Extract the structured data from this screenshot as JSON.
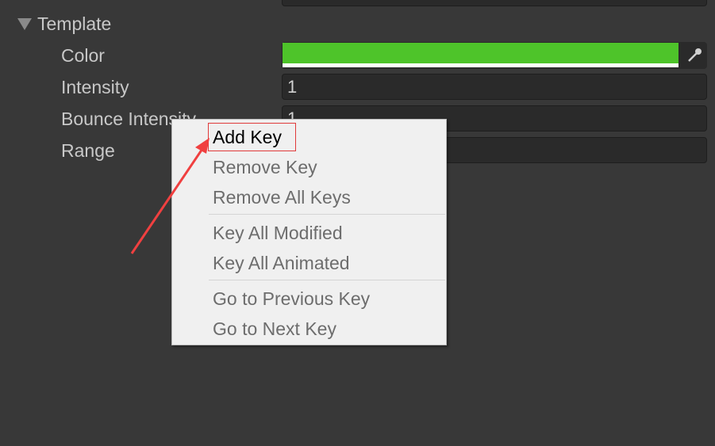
{
  "section": {
    "title": "Template",
    "expanded": true
  },
  "properties": [
    {
      "label": "Color",
      "value": "#4ec42a"
    },
    {
      "label": "Intensity",
      "value": "1"
    },
    {
      "label": "Bounce Intensity",
      "value": "1"
    },
    {
      "label": "Range",
      "value": ""
    }
  ],
  "context_menu": {
    "items": [
      "Add Key",
      "Remove Key",
      "Remove All Keys",
      "Key All Modified",
      "Key All Animated",
      "Go to Previous Key",
      "Go to Next Key"
    ],
    "highlighted": "Add Key"
  },
  "colors": {
    "annotation": "#f04040",
    "swatch": "#4ec42a"
  }
}
